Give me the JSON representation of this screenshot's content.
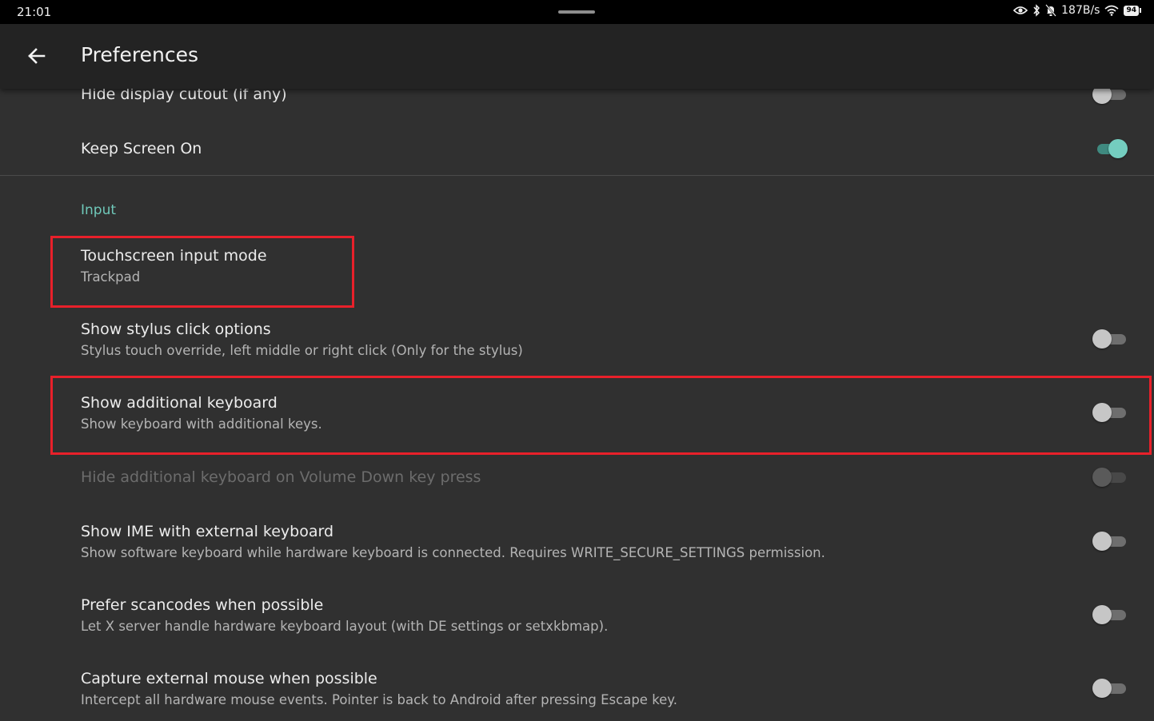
{
  "status_bar": {
    "time": "21:01",
    "network_speed": "187B/s",
    "battery_level": "94",
    "icons": [
      "eye-icon",
      "bluetooth-icon",
      "notifications-off-icon",
      "wifi-icon",
      "battery-icon"
    ]
  },
  "toolbar": {
    "back_icon": "arrow-left-icon",
    "title": "Preferences"
  },
  "settings": {
    "hide_cutout": {
      "title": "Hide display cutout (if any)",
      "enabled": false
    },
    "keep_screen_on": {
      "title": "Keep Screen On",
      "enabled": true
    },
    "section_input": "Input",
    "touchscreen_mode": {
      "title": "Touchscreen input mode",
      "summary": "Trackpad"
    },
    "stylus_click": {
      "title": "Show stylus click options",
      "summary": "Stylus touch override, left middle or right click (Only for the stylus)",
      "enabled": false
    },
    "additional_keyboard": {
      "title": "Show additional keyboard",
      "summary": "Show keyboard with additional keys.",
      "enabled": false
    },
    "hide_keyboard_volume": {
      "title": "Hide additional keyboard on Volume Down key press",
      "enabled": false,
      "disabled": true
    },
    "ime_external": {
      "title": "Show IME with external keyboard",
      "summary": "Show software keyboard while hardware keyboard is connected. Requires WRITE_SECURE_SETTINGS permission.",
      "enabled": false
    },
    "scancodes": {
      "title": "Prefer scancodes when possible",
      "summary": "Let X server handle hardware keyboard layout (with DE settings or setxkbmap).",
      "enabled": false
    },
    "capture_mouse": {
      "title": "Capture external mouse when possible",
      "summary": "Intercept all hardware mouse events. Pointer is back to Android after pressing Escape key.",
      "enabled": false
    }
  },
  "colors": {
    "accent": "#6fc8b9",
    "highlight_box": "#e8202a",
    "background": "#303030"
  }
}
